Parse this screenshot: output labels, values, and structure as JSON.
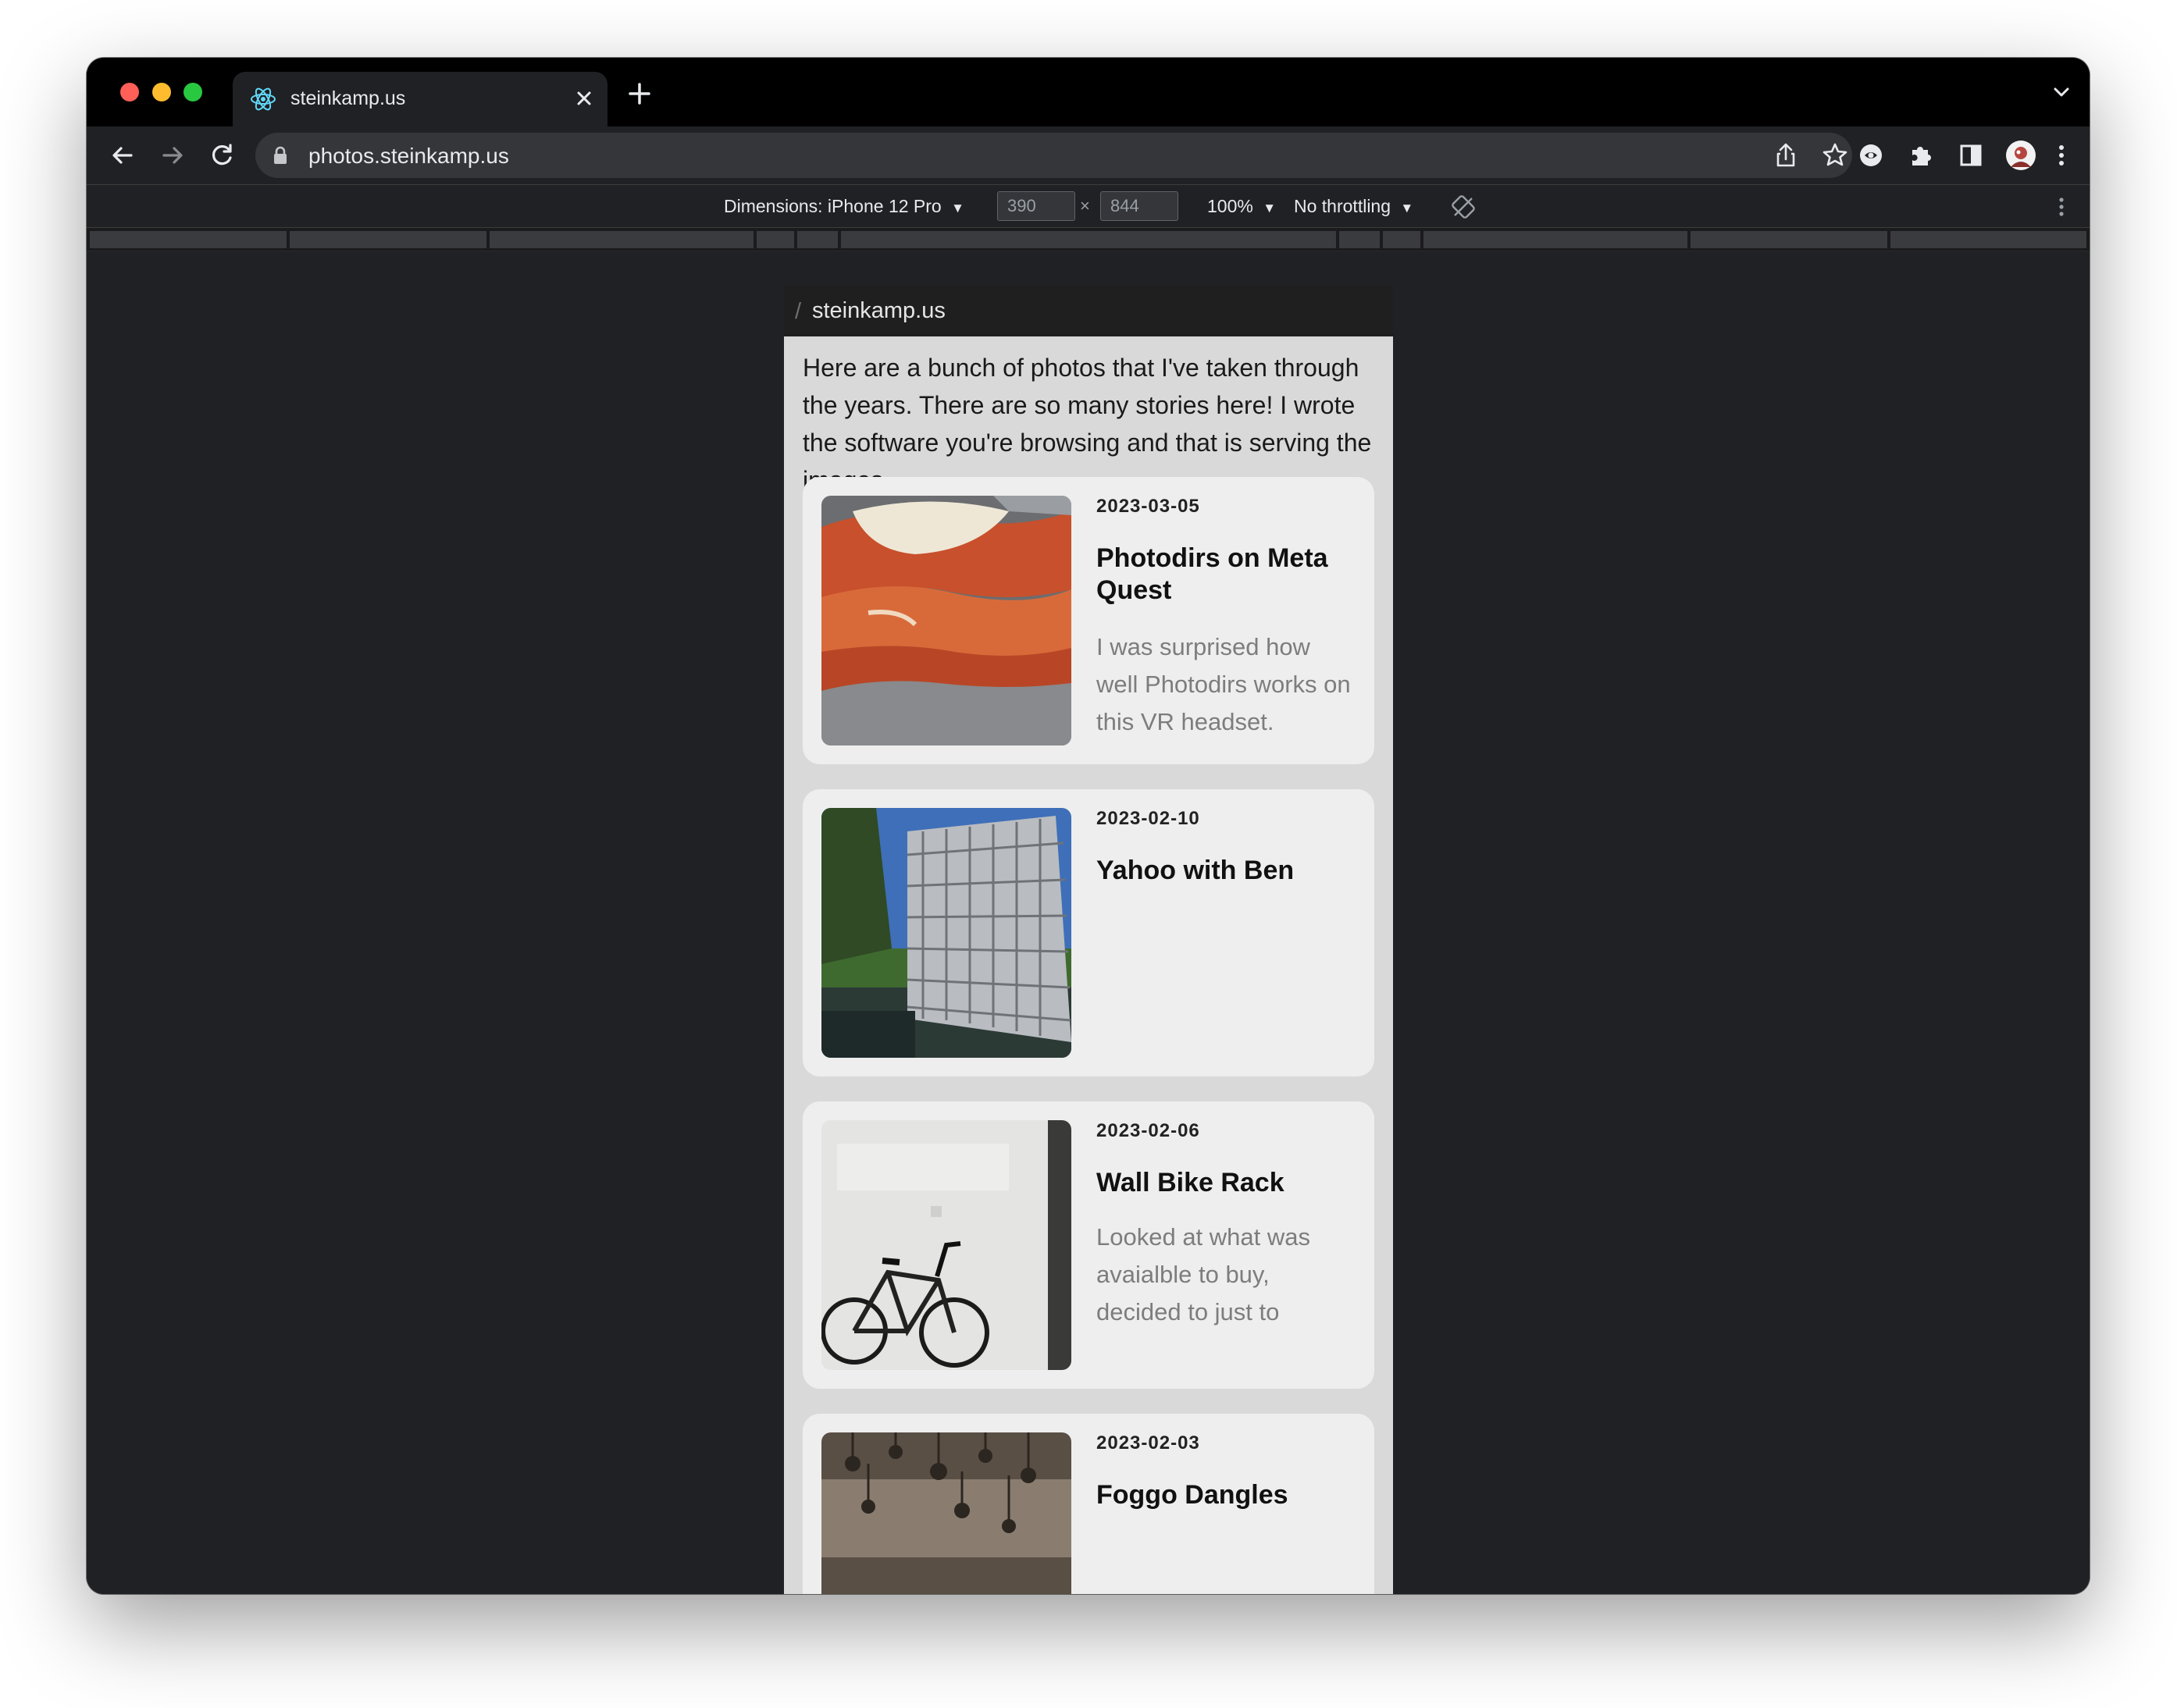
{
  "browser": {
    "tab_title": "steinkamp.us",
    "url": "photos.steinkamp.us"
  },
  "devtools": {
    "dimensions_label": "Dimensions: iPhone 12 Pro",
    "width_value": "390",
    "height_value": "844",
    "times": "×",
    "zoom": "100%",
    "throttling": "No throttling"
  },
  "page": {
    "breadcrumb_separator": "/",
    "breadcrumb": "steinkamp.us",
    "intro": "Here are a bunch of photos that I've taken through the years. There are so many stories here! I wrote the software you're browsing and that is serving the images.",
    "posts": [
      {
        "date": "2023-03-05",
        "title": "Photodirs on Meta Quest",
        "description": "I was surprised how well Photodirs works on this VR headset."
      },
      {
        "date": "2023-02-10",
        "title": "Yahoo with Ben",
        "description": ""
      },
      {
        "date": "2023-02-06",
        "title": "Wall Bike Rack",
        "description": "Looked at what was avaialble to buy, decided to just to"
      },
      {
        "date": "2023-02-03",
        "title": "Foggo Dangles",
        "description": ""
      }
    ]
  },
  "colors": {
    "window_bg": "#000000",
    "toolbar_bg": "#202124",
    "page_bg": "#d9d9d9",
    "card_bg": "#eeeeee"
  },
  "icons": [
    "react-icon",
    "close-icon",
    "plus-icon",
    "chevron-down-icon",
    "back-arrow-icon",
    "forward-arrow-icon",
    "reload-icon",
    "lock-icon",
    "share-icon",
    "star-icon",
    "extension-icon",
    "puzzle-icon",
    "sidebar-icon",
    "avatar",
    "more-vert-icon",
    "rotate-icon"
  ]
}
